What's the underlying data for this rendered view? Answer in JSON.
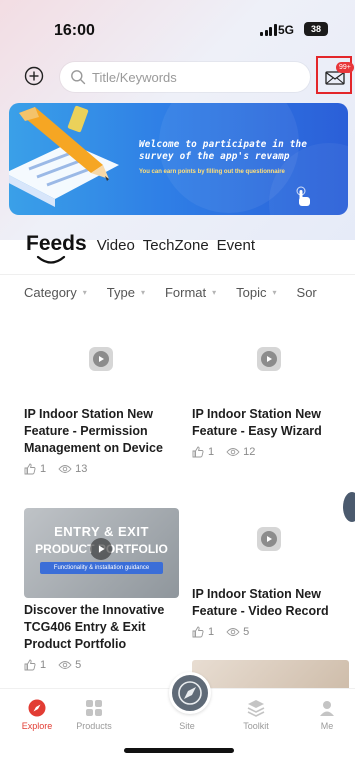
{
  "status_bar": {
    "time": "16:00",
    "network": "5G",
    "battery": "38"
  },
  "search": {
    "placeholder": "Title/Keywords"
  },
  "notifications": {
    "badge": "99+"
  },
  "banner": {
    "title": "Welcome to participate in the survey of the app's revamp",
    "subtitle": "You can earn points by filling out the questionnaire"
  },
  "tabs": [
    {
      "label": "Feeds",
      "active": true
    },
    {
      "label": "Video",
      "active": false
    },
    {
      "label": "TechZone",
      "active": false
    },
    {
      "label": "Event",
      "active": false
    }
  ],
  "filters": [
    "Category",
    "Type",
    "Format",
    "Topic",
    "Sor"
  ],
  "feed": {
    "items": [
      {
        "title": "IP Indoor Station New Feature - Permission Management on Device",
        "likes": "1",
        "views": "13"
      },
      {
        "title": "IP Indoor Station New Feature - Easy Wizard",
        "likes": "1",
        "views": "12"
      },
      {
        "title": "Discover the Innovative TCG406 Entry & Exit Product Portfolio",
        "likes": "1",
        "views": "5",
        "thumb_line1": "ENTRY & EXIT",
        "thumb_line2": "PRODUCT PORTFOLIO",
        "thumb_sub": "Functionality & installation guidance"
      },
      {
        "title": "IP Indoor Station New Feature - Video Record",
        "likes": "1",
        "views": "5"
      }
    ]
  },
  "bottom_nav": [
    {
      "label": "Explore",
      "icon": "explore-icon",
      "active": true
    },
    {
      "label": "Products",
      "icon": "products-icon",
      "active": false
    },
    {
      "label": "Site",
      "icon": "site-icon",
      "active": false
    },
    {
      "label": "Toolkit",
      "icon": "toolkit-icon",
      "active": false
    },
    {
      "label": "Me",
      "icon": "me-icon",
      "active": false
    }
  ],
  "colors": {
    "accent": "#e23c33",
    "banner_blue": "#2f7fe6",
    "notification_red": "#e8363a"
  }
}
